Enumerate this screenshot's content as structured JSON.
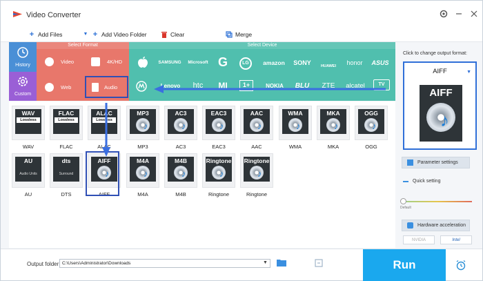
{
  "app": {
    "title": "Video Converter"
  },
  "window_controls": [
    "gear-icon",
    "minimize-icon",
    "close-icon"
  ],
  "toolbar": {
    "add_files": "Add Files",
    "add_video_folder": "Add Video Folder",
    "clear": "Clear",
    "merge": "Merge"
  },
  "side": {
    "history": "History",
    "custom": "Custom"
  },
  "format_section": {
    "title": "Select Format",
    "buttons": [
      "Video",
      "4K/HD",
      "Web",
      "Audio"
    ]
  },
  "device_section": {
    "title": "Select Device",
    "row1": [
      "apple",
      "SAMSUNG",
      "Microsoft",
      "G",
      "LG",
      "amazon",
      "SONY",
      "HUAWEI",
      "honor",
      "ASUS"
    ],
    "row2": [
      "motorola",
      "Lenovo",
      "htc",
      "MI",
      "1+",
      "NOKIA",
      "BLU",
      "ZTE",
      "alcatel",
      "TV"
    ]
  },
  "formats": [
    {
      "badge": "WAV",
      "label": "WAV",
      "sub": "Lossless"
    },
    {
      "badge": "FLAC",
      "label": "FLAC",
      "sub": "Lossless"
    },
    {
      "badge": "ALAC",
      "label": "ALAC",
      "sub": "Lossless"
    },
    {
      "badge": "MP3",
      "label": "MP3",
      "sub": ""
    },
    {
      "badge": "AC3",
      "label": "AC3",
      "sub": ""
    },
    {
      "badge": "EAC3",
      "label": "EAC3",
      "sub": ""
    },
    {
      "badge": "AAC",
      "label": "AAC",
      "sub": ""
    },
    {
      "badge": "WMA",
      "label": "WMA",
      "sub": ""
    },
    {
      "badge": "MKA",
      "label": "MKA",
      "sub": ""
    },
    {
      "badge": "OGG",
      "label": "OGG",
      "sub": ""
    },
    {
      "badge": "AU",
      "label": "AU",
      "sub": "Audio Units"
    },
    {
      "badge": "dts",
      "label": "DTS",
      "sub": "Surround"
    },
    {
      "badge": "AIFF",
      "label": "AIFF",
      "sub": ""
    },
    {
      "badge": "M4A",
      "label": "M4A",
      "sub": ""
    },
    {
      "badge": "M4B",
      "label": "M4B",
      "sub": ""
    },
    {
      "badge": "Ringtone",
      "label": "Ringtone",
      "sub": ""
    },
    {
      "badge": "Ringtone",
      "label": "Ringtone",
      "sub": ""
    }
  ],
  "right_panel": {
    "hint": "Click to change output format:",
    "selected_format": "AIFF",
    "parameter_settings": "Parameter settings",
    "quick_setting": "Quick setting",
    "default_label": "Default",
    "hardware_acceleration": "Hardware acceleration",
    "nvidia": "NVIDIA",
    "intel": "Intel"
  },
  "bottom": {
    "output_folder_label": "Output folder:",
    "output_folder_value": "C:\\Users\\Administrator\\Downloads",
    "run": "Run"
  },
  "colors": {
    "format_bg": "#e8776b",
    "device_bg": "#50bfae",
    "run_bg": "#1aa8ee",
    "highlight": "#2f4fb5",
    "arrow": "#3a6ee0"
  }
}
